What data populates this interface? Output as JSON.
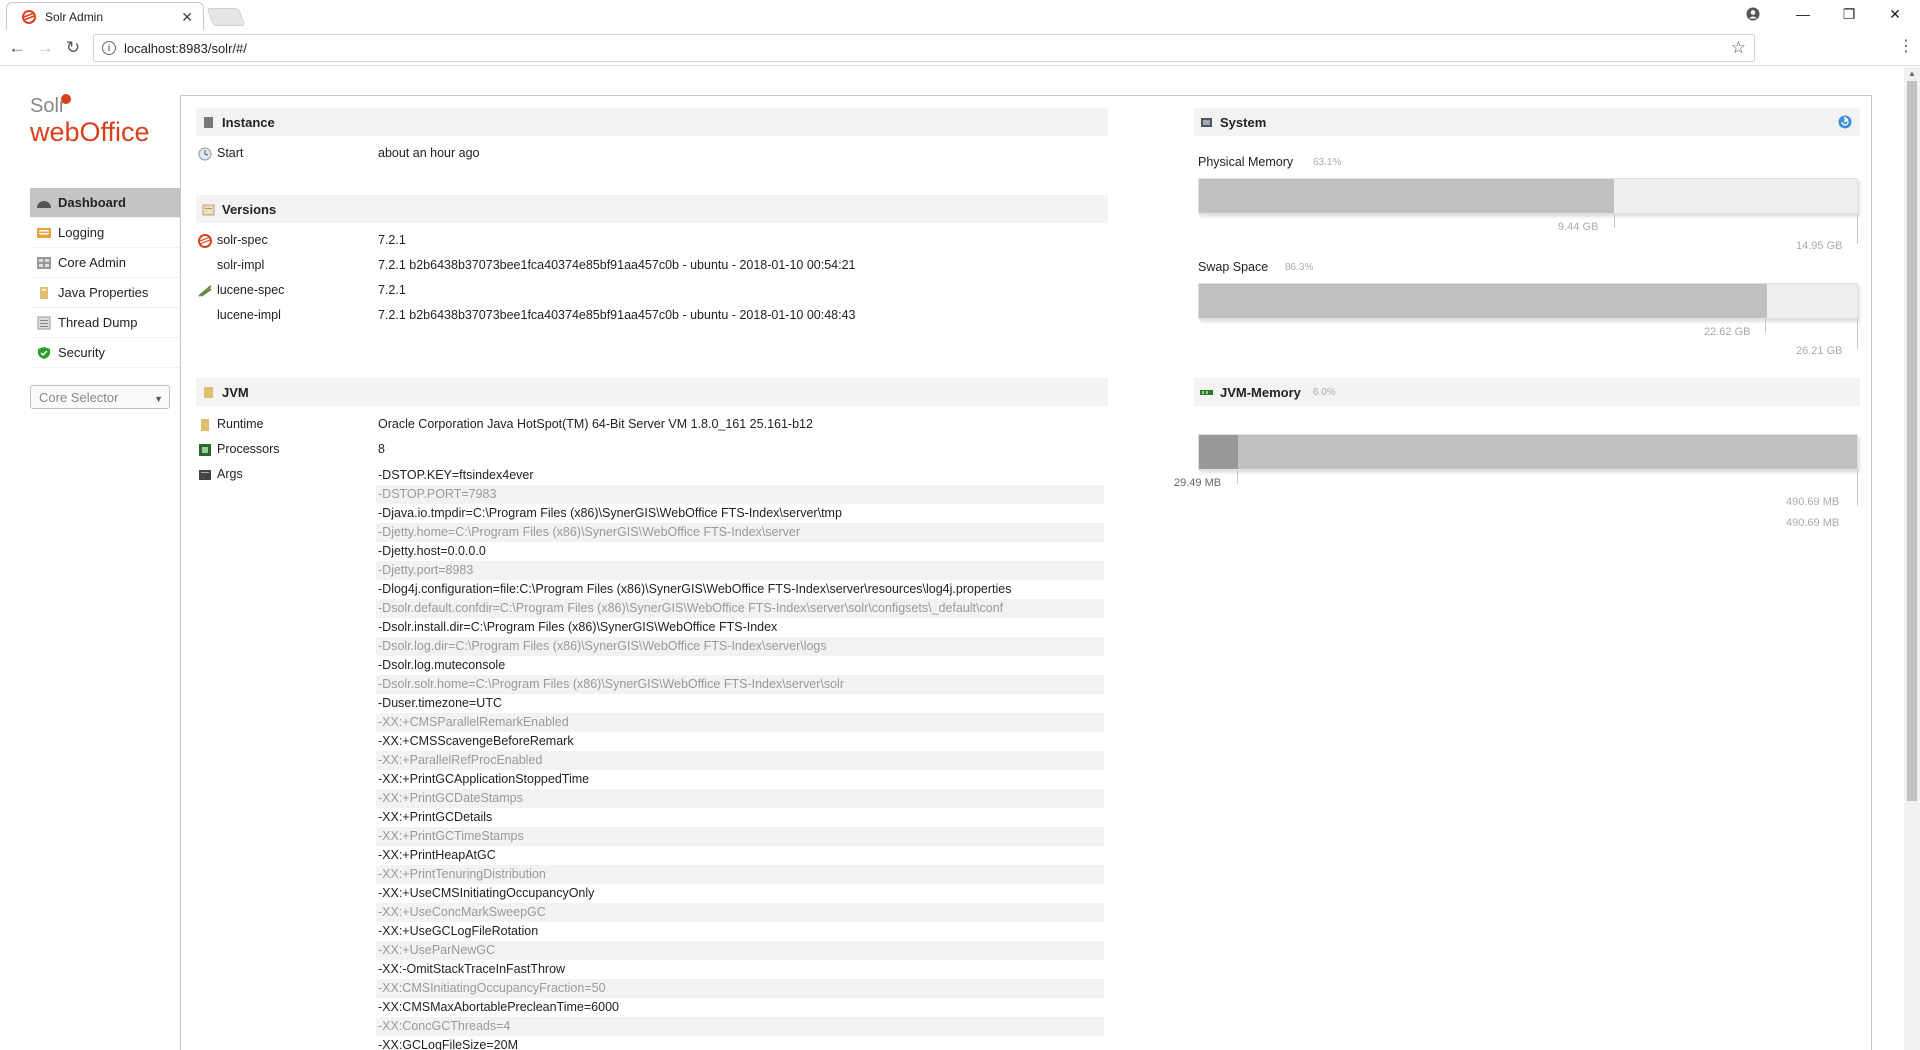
{
  "browser": {
    "tab_title": "Solr Admin",
    "url": "localhost:8983/solr/#/"
  },
  "logo": {
    "line1": "Solr",
    "line2_a": "web",
    "line2_b": "Office"
  },
  "sidebar": {
    "items": [
      {
        "label": "Dashboard",
        "active": true
      },
      {
        "label": "Logging"
      },
      {
        "label": "Core Admin"
      },
      {
        "label": "Java Properties"
      },
      {
        "label": "Thread Dump"
      },
      {
        "label": "Security"
      }
    ],
    "core_selector": "Core Selector"
  },
  "instance": {
    "title": "Instance",
    "start_label": "Start",
    "start_value": "about an hour ago"
  },
  "versions": {
    "title": "Versions",
    "rows": [
      {
        "label": "solr-spec",
        "value": "7.2.1"
      },
      {
        "label": "solr-impl",
        "value": "7.2.1 b2b6438b37073bee1fca40374e85bf91aa457c0b - ubuntu - 2018-01-10 00:54:21"
      },
      {
        "label": "lucene-spec",
        "value": "7.2.1"
      },
      {
        "label": "lucene-impl",
        "value": "7.2.1 b2b6438b37073bee1fca40374e85bf91aa457c0b - ubuntu - 2018-01-10 00:48:43"
      }
    ]
  },
  "jvm": {
    "title": "JVM",
    "runtime_label": "Runtime",
    "runtime_value": "Oracle Corporation Java HotSpot(TM) 64-Bit Server VM 1.8.0_161 25.161-b12",
    "processors_label": "Processors",
    "processors_value": "8",
    "args_label": "Args",
    "args": [
      "-DSTOP.KEY=ftsindex4ever",
      "-DSTOP.PORT=7983",
      "-Djava.io.tmpdir=C:\\Program Files (x86)\\SynerGIS\\WebOffice FTS-Index\\server\\tmp",
      "-Djetty.home=C:\\Program Files (x86)\\SynerGIS\\WebOffice FTS-Index\\server",
      "-Djetty.host=0.0.0.0",
      "-Djetty.port=8983",
      "-Dlog4j.configuration=file:C:\\Program Files (x86)\\SynerGIS\\WebOffice FTS-Index\\server\\resources\\log4j.properties",
      "-Dsolr.default.confdir=C:\\Program Files (x86)\\SynerGIS\\WebOffice FTS-Index\\server\\solr\\configsets\\_default\\conf",
      "-Dsolr.install.dir=C:\\Program Files (x86)\\SynerGIS\\WebOffice FTS-Index",
      "-Dsolr.log.dir=C:\\Program Files (x86)\\SynerGIS\\WebOffice FTS-Index\\server\\logs",
      "-Dsolr.log.muteconsole",
      "-Dsolr.solr.home=C:\\Program Files (x86)\\SynerGIS\\WebOffice FTS-Index\\server\\solr",
      "-Duser.timezone=UTC",
      "-XX:+CMSParallelRemarkEnabled",
      "-XX:+CMSScavengeBeforeRemark",
      "-XX:+ParallelRefProcEnabled",
      "-XX:+PrintGCApplicationStoppedTime",
      "-XX:+PrintGCDateStamps",
      "-XX:+PrintGCDetails",
      "-XX:+PrintGCTimeStamps",
      "-XX:+PrintHeapAtGC",
      "-XX:+PrintTenuringDistribution",
      "-XX:+UseCMSInitiatingOccupancyOnly",
      "-XX:+UseConcMarkSweepGC",
      "-XX:+UseGCLogFileRotation",
      "-XX:+UseParNewGC",
      "-XX:-OmitStackTraceInFastThrow",
      "-XX:CMSInitiatingOccupancyFraction=50",
      "-XX:CMSMaxAbortablePrecleanTime=6000",
      "-XX:ConcGCThreads=4",
      "-XX:GCLogFileSize=20M"
    ]
  },
  "system": {
    "title": "System",
    "physical": {
      "label": "Physical Memory",
      "percent": "63.1%",
      "used": "9.44 GB",
      "total": "14.95 GB",
      "fraction": 0.631
    },
    "swap": {
      "label": "Swap Space",
      "percent": "86.3%",
      "used": "22.62 GB",
      "total": "26.21 GB",
      "fraction": 0.863
    }
  },
  "jvm_memory": {
    "title": "JVM-Memory",
    "percent": "6.0%",
    "used": "29.49 MB",
    "max": "490.69 MB",
    "committed": "490.69 MB",
    "used_fraction": 0.06
  },
  "colors": {
    "solr_red": "#d9411e",
    "active_nav": "#c4c4c4"
  }
}
